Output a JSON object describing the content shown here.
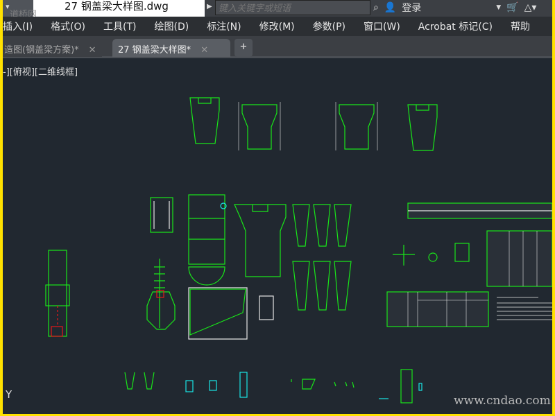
{
  "window": {
    "menu_glyph": "▾",
    "title": "27 钢盖梁大样图.dwg",
    "logo": "道桥网",
    "search_placeholder": "键入关键字或短语",
    "login": "登录",
    "binoculars": "binoculars-icon",
    "cart": "cart-icon"
  },
  "menu": [
    "插入(I)",
    "格式(O)",
    "工具(T)",
    "绘图(D)",
    "标注(N)",
    "修改(M)",
    "参数(P)",
    "窗口(W)",
    "Acrobat 标记(C)",
    "帮助"
  ],
  "tabs": [
    {
      "label": "造图(钢盖梁方案)*",
      "close": "✕"
    },
    {
      "label": "27 钢盖梁大样图*",
      "close": "✕"
    }
  ],
  "tab_add": "+",
  "viewport_label": "-][俯视][二维线框]",
  "ucs": "Y",
  "watermark": "www.cndao.com",
  "colors": {
    "line": "#19e619",
    "cyan": "#19e6e6",
    "white": "#e6e6e6",
    "bg": "#212830"
  }
}
